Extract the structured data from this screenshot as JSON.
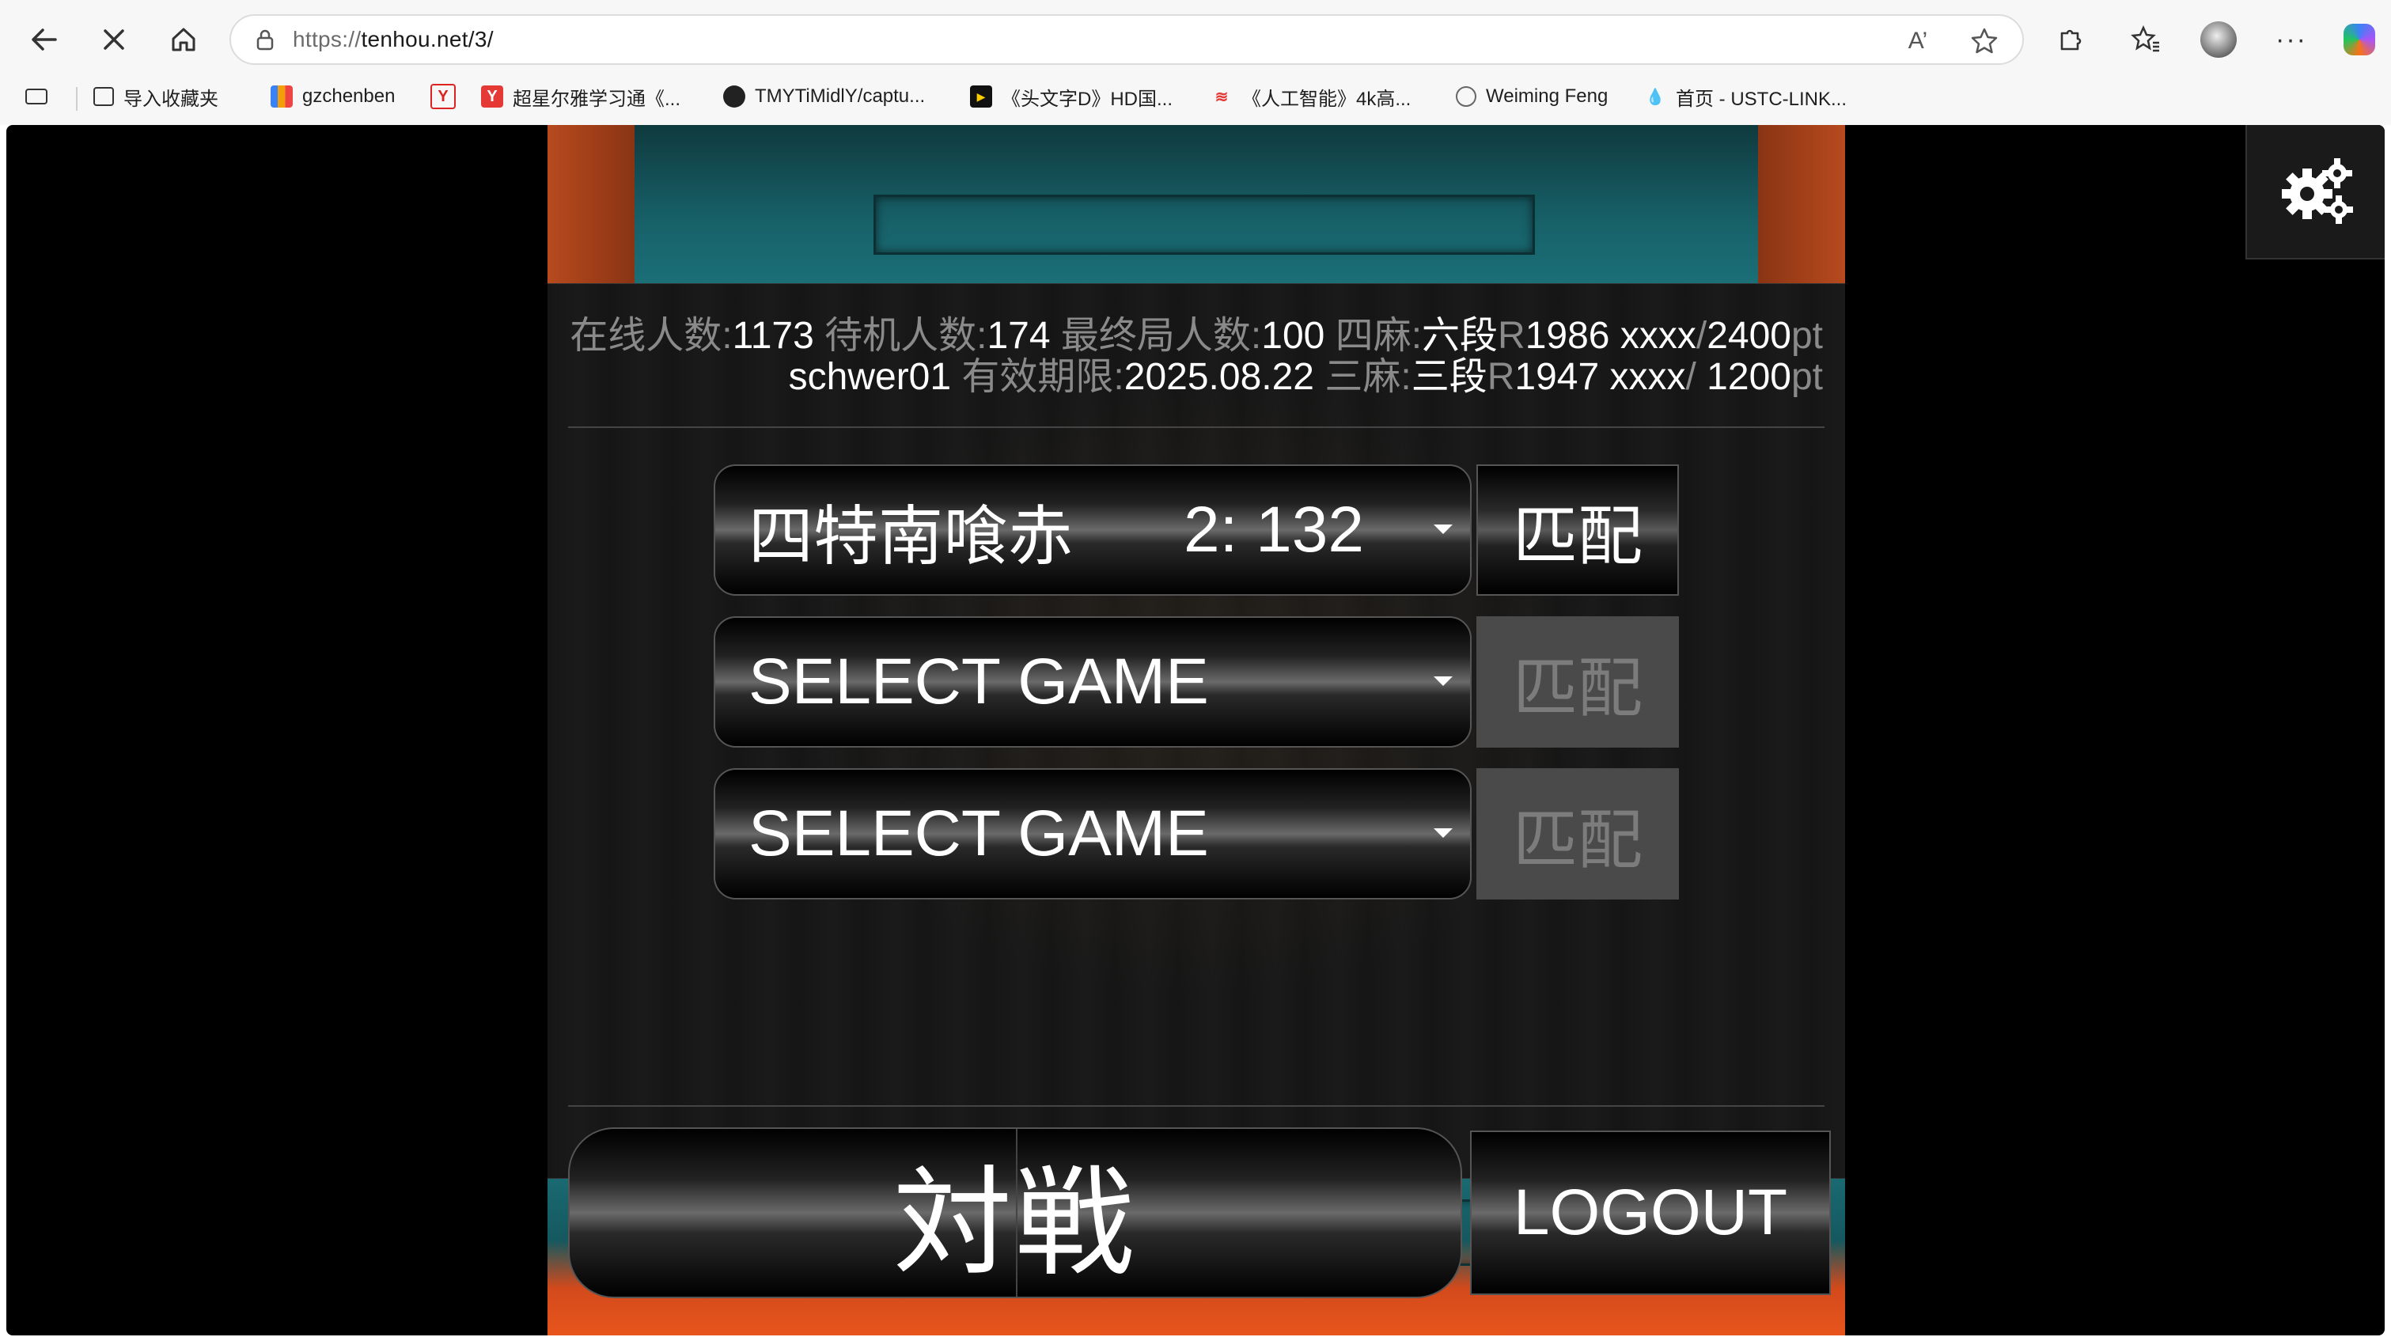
{
  "browser": {
    "url_proto": "https://",
    "url_host": "tenhou.net/3/",
    "read_aloud_label": "A’",
    "bookmarks": [
      {
        "label": "导入收藏夹",
        "icon": "import-icon"
      },
      {
        "label": "gzchenben",
        "icon": "chart-icon"
      },
      {
        "label": "",
        "icon": "y-logo-icon"
      },
      {
        "label": "超星尔雅学习通《...",
        "icon": "chaoxing-icon"
      },
      {
        "label": "TMYTiMidlY/captu...",
        "icon": "github-icon"
      },
      {
        "label": "《头文字D》HD国...",
        "icon": "movie-icon"
      },
      {
        "label": "《人工智能》4k高...",
        "icon": "video-icon"
      },
      {
        "label": "Weiming Feng",
        "icon": "globe-icon"
      },
      {
        "label": "首页 - USTC-LINK...",
        "icon": "drop-icon"
      }
    ]
  },
  "stats": {
    "online_label": "在线人数:",
    "online_value": "1173",
    "waiting_label": "待机人数:",
    "waiting_value": "174",
    "final_label": "最终局人数:",
    "final_value": "100",
    "four_label": "四麻:",
    "four_rank": "六段",
    "four_r_label": "R",
    "four_rating": "1986 xxxx",
    "four_slash": "/",
    "four_pt": "2400",
    "pt_label": "pt",
    "user": "schwer01",
    "expire_label": "有效期限:",
    "expire_value": "2025.08.22",
    "three_label": "三麻:",
    "three_rank": "三段",
    "three_r_label": "R",
    "three_rating": "1947 xxxx",
    "three_slash": "/",
    "three_pt": " 1200",
    "three_pt_label": "pt"
  },
  "games": [
    {
      "name": "四特南喰赤",
      "count": "2: 132",
      "match_label": "匹配",
      "enabled": true
    },
    {
      "name": "SELECT GAME",
      "count": "",
      "match_label": "匹配",
      "enabled": false
    },
    {
      "name": "SELECT GAME",
      "count": "",
      "match_label": "匹配",
      "enabled": false
    }
  ],
  "taisen_label": "対戦",
  "logout_label": "LOGOUT"
}
